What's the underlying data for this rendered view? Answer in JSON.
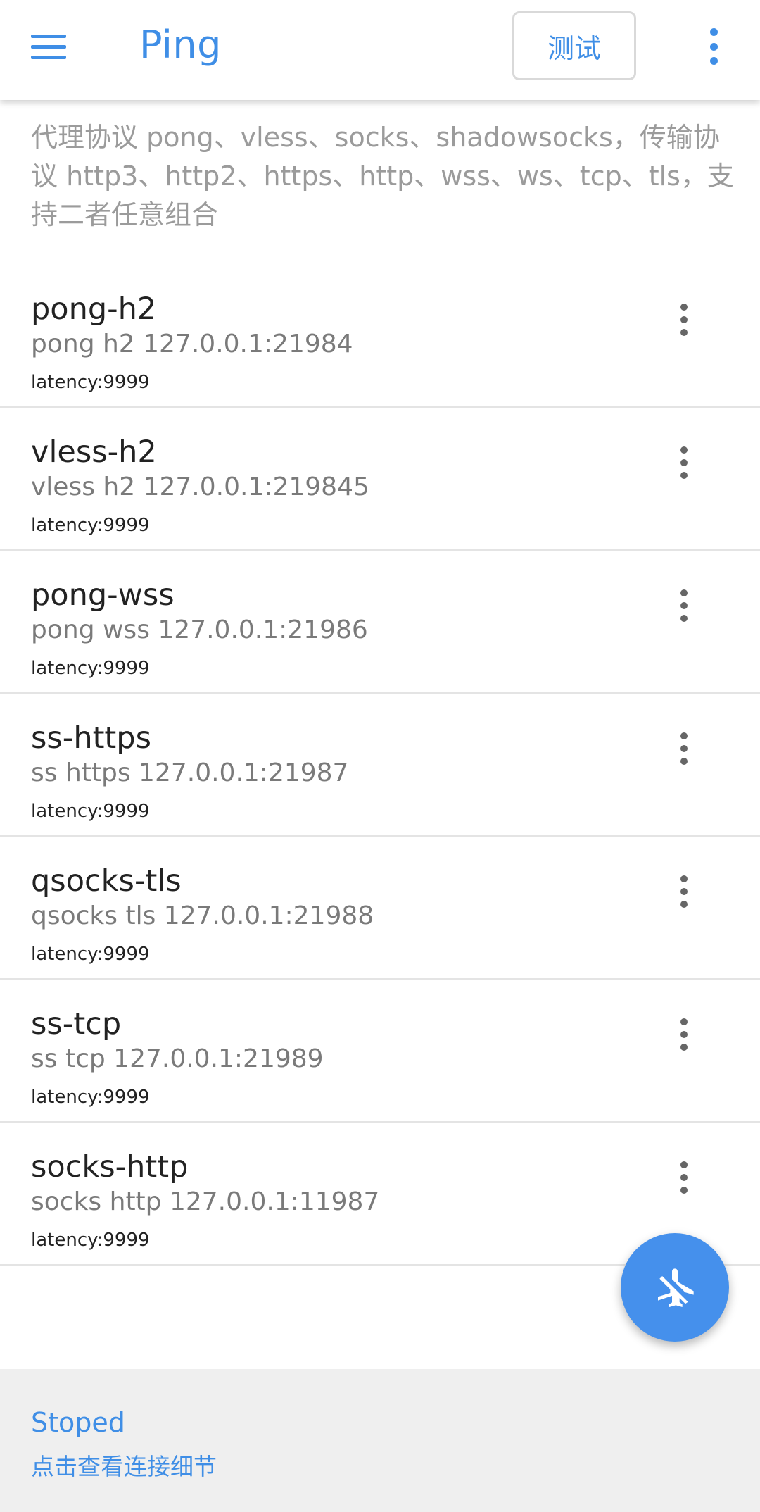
{
  "appbar": {
    "menu_icon": "hamburger-menu-icon",
    "title": "Ping",
    "test_button": "测试",
    "overflow_icon": "more-vert-icon"
  },
  "description": "代理协议 pong、vless、socks、shadowsocks，传输协议 http3、http2、https、http、wss、ws、tcp、tls，支持二者任意组合",
  "servers": [
    {
      "name": "pong-h2",
      "address": "pong h2 127.0.0.1:21984",
      "latency": "latency:9999"
    },
    {
      "name": "vless-h2",
      "address": "vless h2 127.0.0.1:219845",
      "latency": "latency:9999"
    },
    {
      "name": "pong-wss",
      "address": "pong wss 127.0.0.1:21986",
      "latency": "latency:9999"
    },
    {
      "name": "ss-https",
      "address": "ss https 127.0.0.1:21987",
      "latency": "latency:9999"
    },
    {
      "name": "qsocks-tls",
      "address": "qsocks tls 127.0.0.1:21988",
      "latency": "latency:9999"
    },
    {
      "name": "ss-tcp",
      "address": "ss tcp 127.0.0.1:21989",
      "latency": "latency:9999"
    },
    {
      "name": "socks-http",
      "address": "socks http 127.0.0.1:11987",
      "latency": "latency:9999"
    }
  ],
  "fab": {
    "icon": "airplane-off-icon"
  },
  "status": {
    "state": "Stoped",
    "detail": "点击查看连接细节"
  },
  "colors": {
    "accent": "#3f8ee6",
    "fab": "#4590ec",
    "bottom_panel": "#efefef"
  }
}
